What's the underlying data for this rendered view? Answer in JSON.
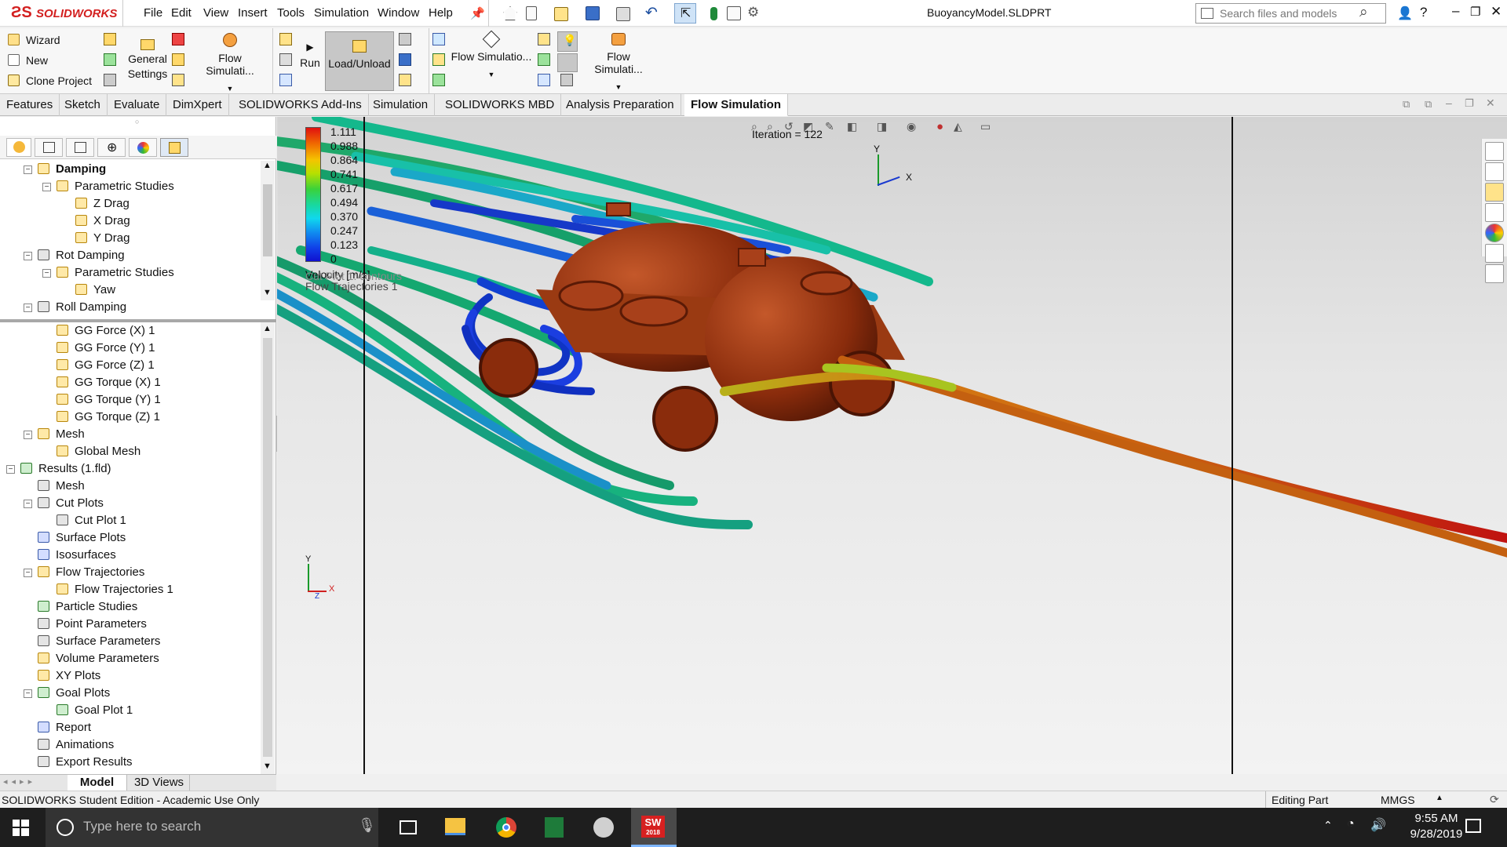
{
  "app": {
    "brand": "SOLIDWORKS",
    "file_title": "BuoyancyModel.SLDPRT",
    "search_placeholder": "Search files and models"
  },
  "menu": [
    "File",
    "Edit",
    "View",
    "Insert",
    "Tools",
    "Simulation",
    "Window",
    "Help"
  ],
  "ribbon": {
    "wizard": "Wizard",
    "new": "New",
    "clone_project": "Clone Project",
    "general_settings": "General Settings",
    "flow_sim_1": "Flow Simulati...",
    "run": "Run",
    "load_unload": "Load/Unload",
    "flow_sim_2": "Flow Simulatio...",
    "flow_sim_3": "Flow Simulati..."
  },
  "tabs": [
    {
      "label": "Features",
      "active": false
    },
    {
      "label": "Sketch",
      "active": false
    },
    {
      "label": "Evaluate",
      "active": false
    },
    {
      "label": "DimXpert",
      "active": false
    },
    {
      "label": "SOLIDWORKS Add-Ins",
      "active": false
    },
    {
      "label": "Simulation",
      "active": false
    },
    {
      "label": "SOLIDWORKS MBD",
      "active": false
    },
    {
      "label": "Analysis Preparation",
      "active": false
    },
    {
      "label": "Flow Simulation",
      "active": true
    }
  ],
  "tree_top": [
    {
      "label": "Damping",
      "bold": true
    },
    {
      "label": "Parametric Studies"
    },
    {
      "label": "Z Drag"
    },
    {
      "label": "X Drag"
    },
    {
      "label": "Y Drag"
    },
    {
      "label": "Rot Damping"
    },
    {
      "label": "Parametric Studies"
    },
    {
      "label": "Yaw"
    },
    {
      "label": "Roll Damping"
    }
  ],
  "tree_bottom": [
    {
      "label": "GG Force (X) 1"
    },
    {
      "label": "GG Force (Y) 1"
    },
    {
      "label": "GG Force (Z) 1"
    },
    {
      "label": "GG Torque (X) 1"
    },
    {
      "label": "GG Torque (Y) 1"
    },
    {
      "label": "GG Torque (Z) 1"
    },
    {
      "label": "Mesh"
    },
    {
      "label": "Global Mesh"
    },
    {
      "label": "Results (1.fld)"
    },
    {
      "label": "Mesh"
    },
    {
      "label": "Cut Plots"
    },
    {
      "label": "Cut Plot 1"
    },
    {
      "label": "Surface Plots"
    },
    {
      "label": "Isosurfaces"
    },
    {
      "label": "Flow Trajectories"
    },
    {
      "label": "Flow Trajectories 1"
    },
    {
      "label": "Particle Studies"
    },
    {
      "label": "Point Parameters"
    },
    {
      "label": "Surface Parameters"
    },
    {
      "label": "Volume Parameters"
    },
    {
      "label": "XY Plots"
    },
    {
      "label": "Goal Plots"
    },
    {
      "label": "Goal Plot 1"
    },
    {
      "label": "Report"
    },
    {
      "label": "Animations"
    },
    {
      "label": "Export Results"
    }
  ],
  "bottom_tabs": {
    "model": "Model",
    "views": "3D Views"
  },
  "viewport": {
    "iteration": "Iteration = 122",
    "legend_title": "Velocity [m/s]",
    "legend_values": [
      "1.111",
      "0.988",
      "0.864",
      "0.741",
      "0.617",
      "0.494",
      "0.370",
      "0.247",
      "0.123",
      "0"
    ],
    "legend_colors": [
      "#e01010",
      "#f06a00",
      "#f5c400",
      "#b8e000",
      "#3ad23a",
      "#18d8a0",
      "#10d8ee",
      "#1090f0",
      "#1040e8",
      "#1010d0"
    ],
    "plot_label_1": "Cut Plot 1: contours",
    "plot_label_2": "Flow Trajectories 1",
    "axis_x": "X",
    "axis_y": "Y",
    "axis_z": "Z"
  },
  "status": {
    "left": "SOLIDWORKS Student Edition - Academic Use Only",
    "mode": "Editing Part",
    "units": "MMGS"
  },
  "taskbar": {
    "search_placeholder": "Type here to search",
    "time": "9:55 AM",
    "date": "9/28/2019",
    "sw_badge": "SW",
    "sw_year": "2018"
  }
}
